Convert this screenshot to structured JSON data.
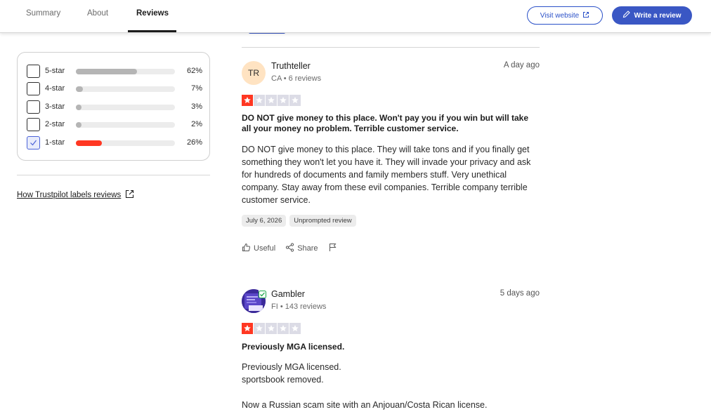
{
  "nav": {
    "tabs": [
      {
        "label": "Summary"
      },
      {
        "label": "About"
      },
      {
        "label": "Reviews"
      }
    ],
    "visit_label": "Visit website",
    "write_label": "Write a review"
  },
  "rating_filter": {
    "rows": [
      {
        "label": "5-star",
        "percent_text": "62%",
        "percent": 62,
        "checked": false
      },
      {
        "label": "4-star",
        "percent_text": "7%",
        "percent": 7,
        "checked": false
      },
      {
        "label": "3-star",
        "percent_text": "3%",
        "percent": 3,
        "checked": false
      },
      {
        "label": "2-star",
        "percent_text": "2%",
        "percent": 2,
        "checked": false
      },
      {
        "label": "1-star",
        "percent_text": "26%",
        "percent": 26,
        "checked": true
      }
    ]
  },
  "labels_link": "How Trustpilot labels reviews",
  "reviews": [
    {
      "initials": "TR",
      "name": "Truthteller",
      "meta": "CA • 6 reviews",
      "date": "A day ago",
      "rating": 1,
      "title": "DO NOT give money to this place. Won't pay you if you win but will take all your money no problem. Terrible customer service.",
      "body": "DO NOT give money to this place. They will take tons and if you finally get something they won't let you have it. They will invade your privacy and ask for hundreds of documents and family members stuff. Very unethical company. Stay away from these evil companies. Terrible company terrible customer service.",
      "experience_date": "July 6, 2026",
      "tag": "Unprompted review",
      "useful_label": "Useful",
      "share_label": "Share"
    },
    {
      "name": "Gambler",
      "meta": "FI • 143 reviews",
      "date": "5 days ago",
      "rating": 1,
      "title": "Previously MGA licensed.",
      "body_line1": "Previously MGA licensed.",
      "body_line2": "sportsbook removed.",
      "body_line3": "Now a Russian scam site with an Anjouan/Costa Rican license."
    }
  ],
  "colors": {
    "accent": "#3a57c4",
    "star_red": "#ff3722",
    "bar_gray": "#b5b5b5"
  }
}
